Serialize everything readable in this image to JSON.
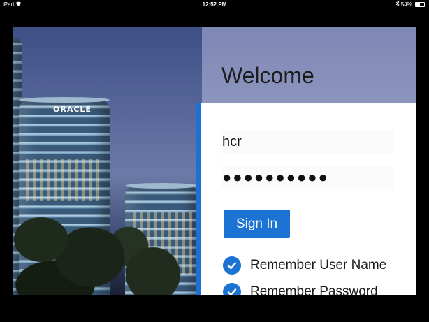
{
  "status_bar": {
    "device": "iPad",
    "time": "12:52 PM",
    "battery": "54%",
    "battery_level": 0.54
  },
  "hero": {
    "brand_sign": "ORACLE"
  },
  "login": {
    "title": "Welcome",
    "username_value": "hcr",
    "password_value": "●●●●●●●●●●",
    "signin_label": "Sign In",
    "remember_user_label": "Remember User Name",
    "remember_password_label": "Remember Password",
    "remember_user_checked": true,
    "remember_password_checked": true
  },
  "colors": {
    "accent": "#1b73d3",
    "header_bg": "#8c95bd"
  },
  "icons": {
    "wifi": "wifi-icon",
    "bluetooth": "bluetooth-icon",
    "battery": "battery-icon",
    "check": "checkmark-circle-icon"
  }
}
